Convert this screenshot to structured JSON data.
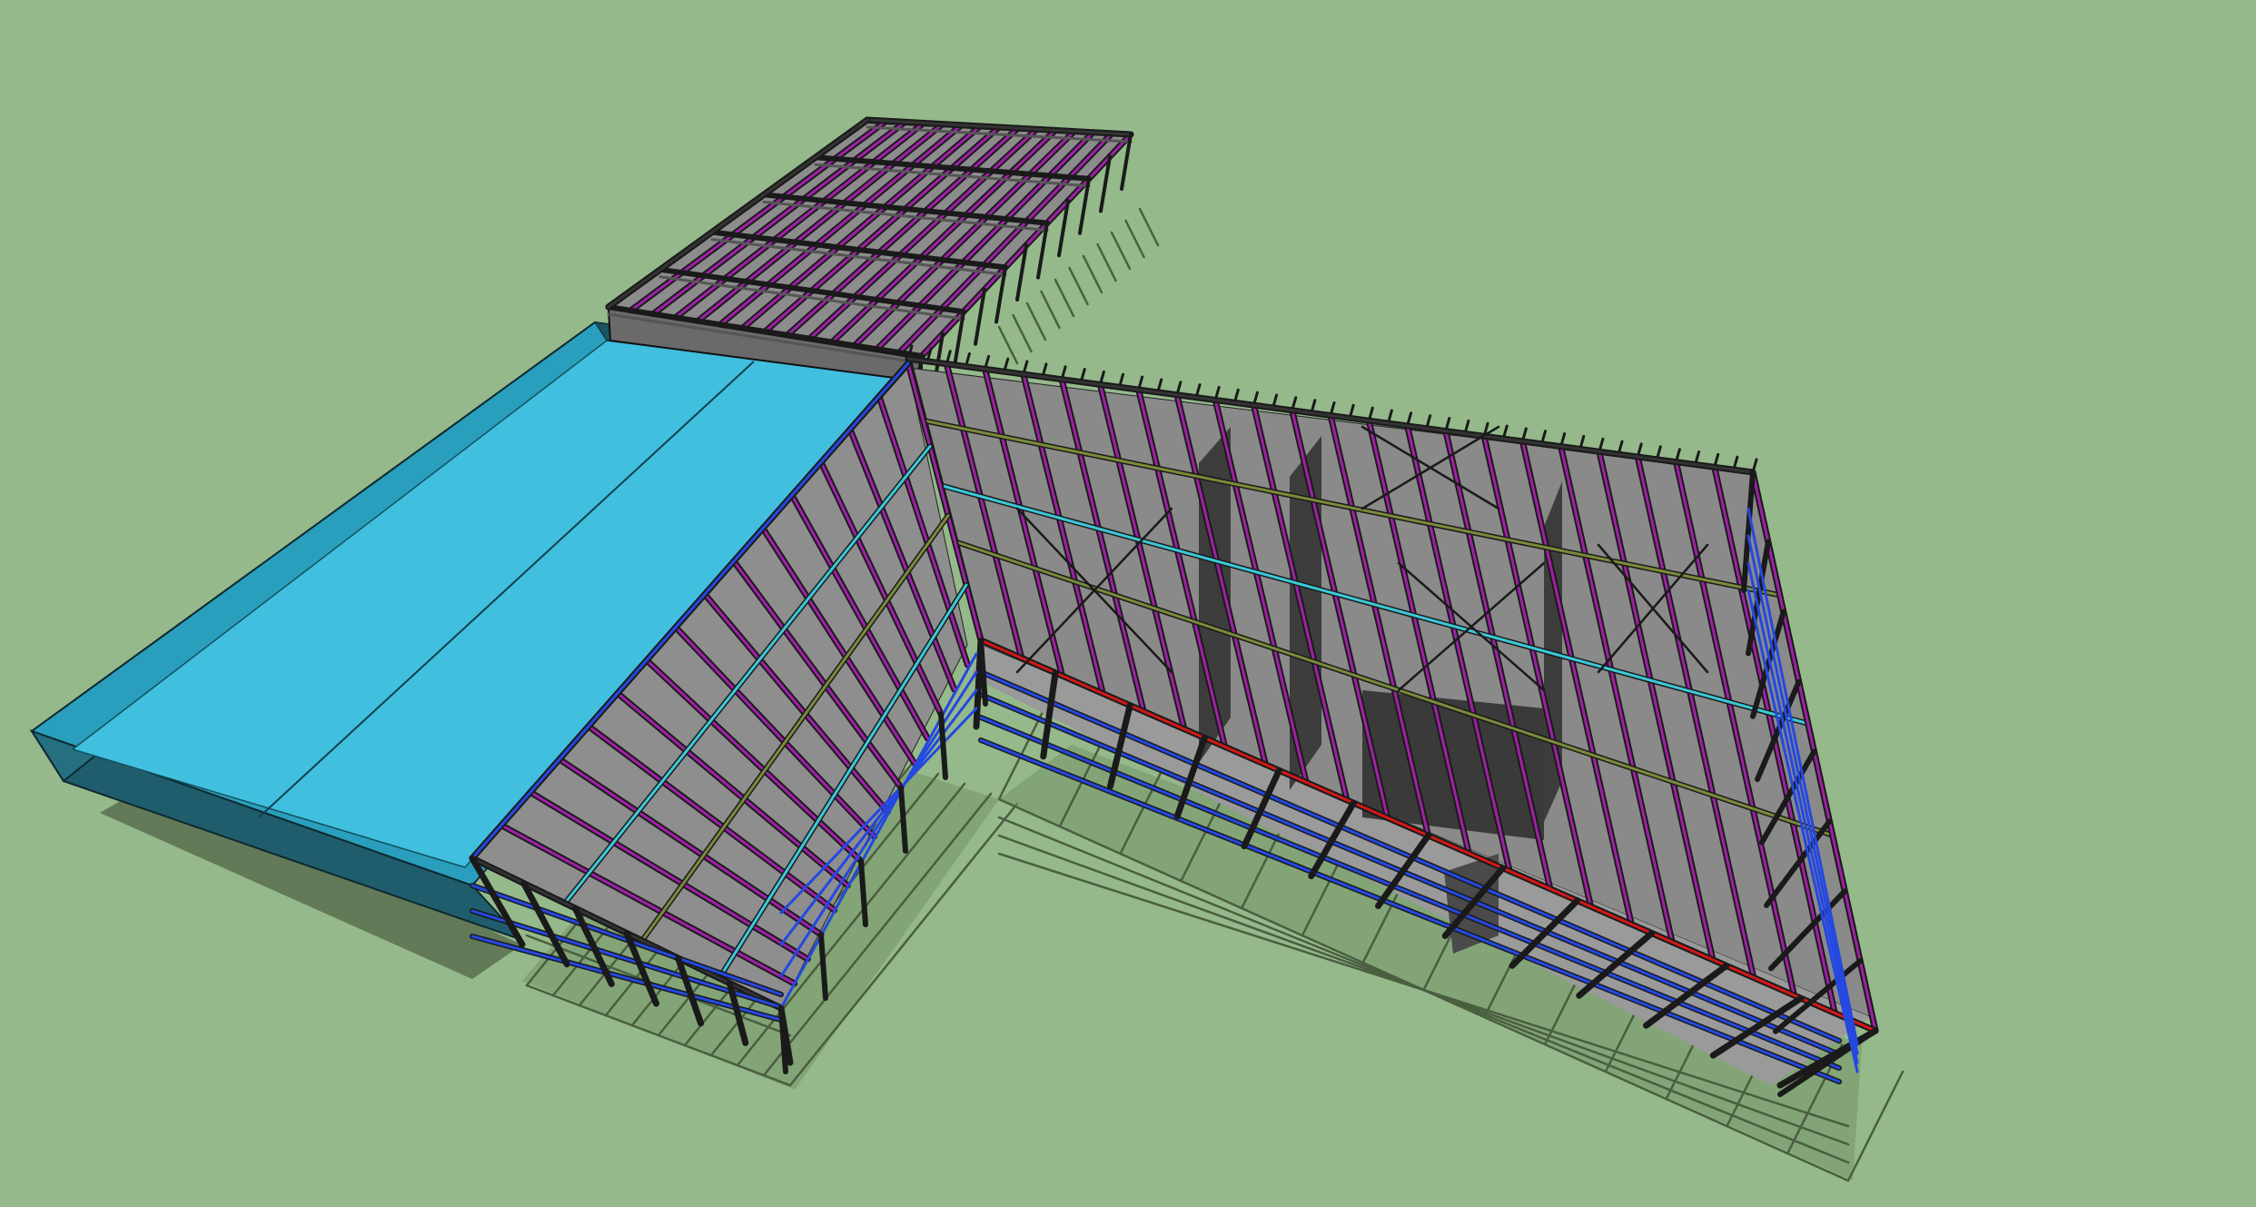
{
  "scene": {
    "background": "#95b98b",
    "colors": {
      "roof_slab": "#41bfdf",
      "roof_slab_side": "#1f5d6c",
      "floor": "#8a8a8a",
      "wall_panel": "#3d3d3d",
      "frame": "#1a1a1a",
      "purlin": "#a020a8",
      "girt": "#2448e0",
      "bracing_cyan": "#3cc8d8",
      "beam_red": "#d01818",
      "beam_olive": "#7a8a3a",
      "shadow": "#445838"
    },
    "objects": [
      "roof-slab",
      "rear-wing-frame",
      "main-frame",
      "left-wing-frame"
    ]
  }
}
